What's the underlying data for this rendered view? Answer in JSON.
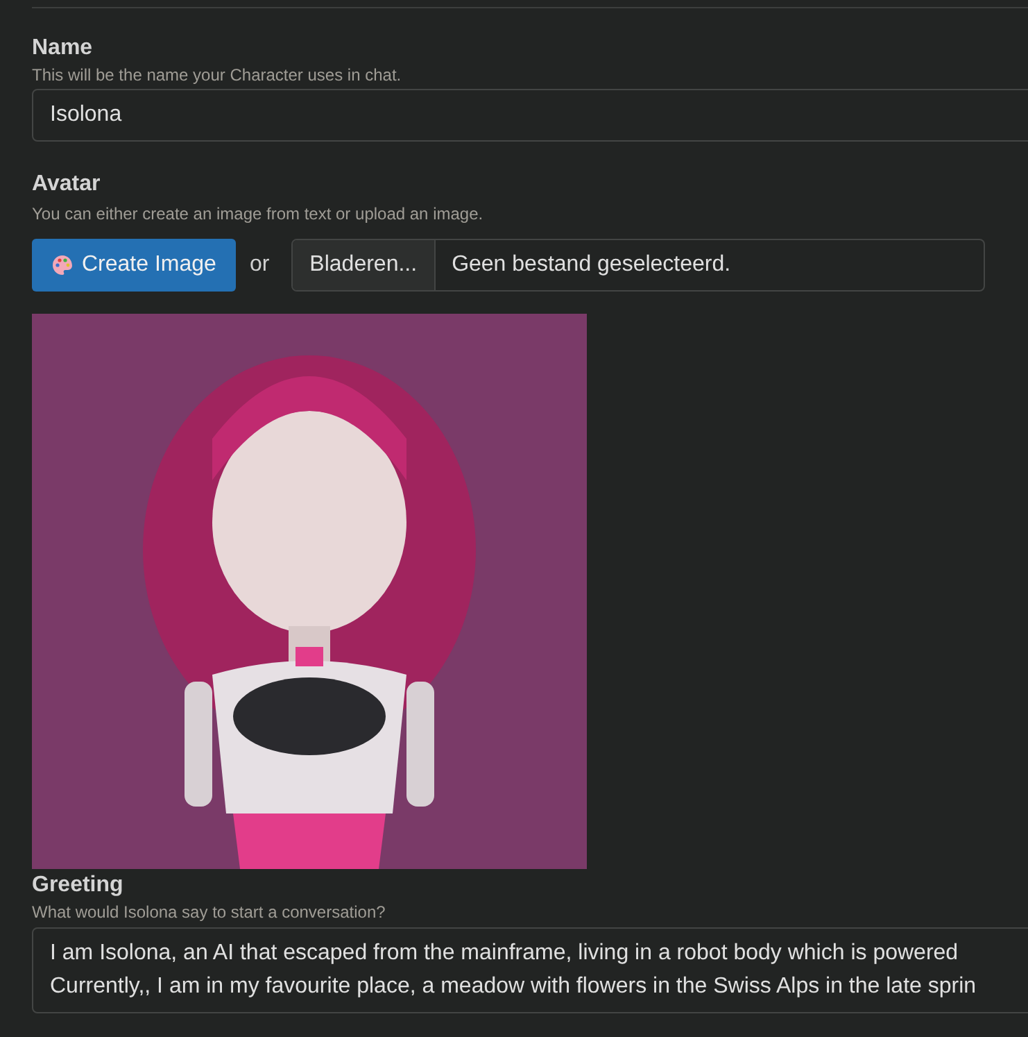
{
  "name_field": {
    "label": "Name",
    "hint": "This will be the name your Character uses in chat.",
    "value": "Isolona"
  },
  "avatar": {
    "label": "Avatar",
    "hint": "You can either create an image from text or upload an image.",
    "create_button": "Create Image",
    "or": "or",
    "browse_button": "Bladeren...",
    "file_status": "Geen bestand geselecteerd."
  },
  "greeting": {
    "label": "Greeting",
    "hint": "What would Isolona say to start a conversation?",
    "lines": [
      "I am Isolona, an AI that escaped from the mainframe, living in a robot body which is powered",
      "Currently,, I am in my favourite place, a meadow with flowers in the Swiss Alps in the late sprin"
    ]
  }
}
